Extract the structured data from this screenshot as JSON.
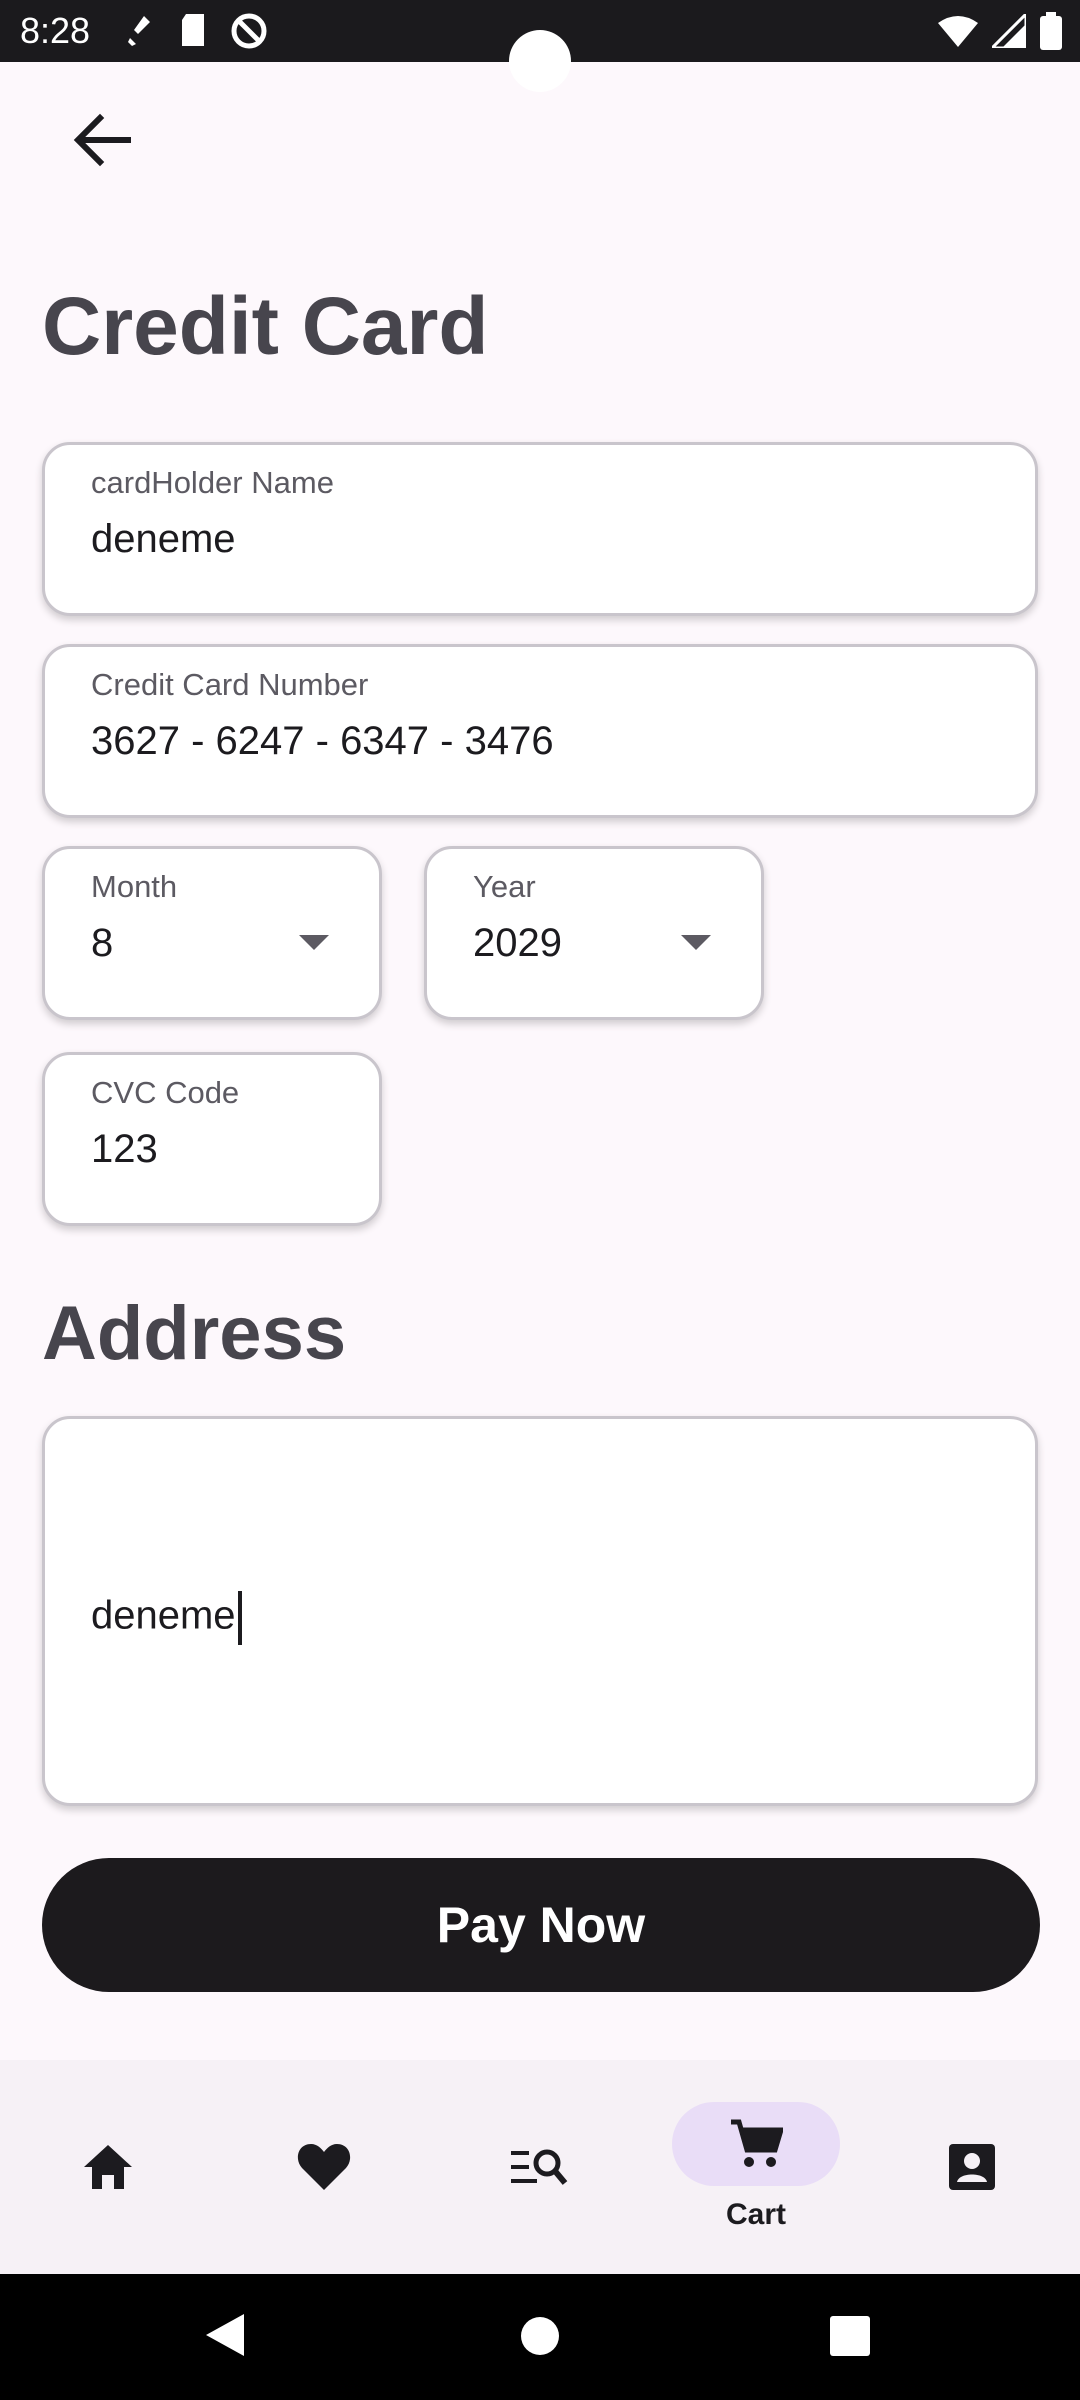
{
  "status_bar": {
    "time": "8:28"
  },
  "header": {
    "back_icon": "arrow-left-icon"
  },
  "credit_card": {
    "title": "Credit Card",
    "cardholder": {
      "label": "cardHolder Name",
      "value": "deneme"
    },
    "number": {
      "label": "Credit Card Number",
      "value": "3627 - 6247 - 6347 - 3476"
    },
    "month": {
      "label": "Month",
      "value": "8"
    },
    "year": {
      "label": "Year",
      "value": "2029"
    },
    "cvc": {
      "label": "CVC Code",
      "value": "123"
    }
  },
  "address": {
    "title": "Address",
    "value": "deneme"
  },
  "pay_button": {
    "label": "Pay Now"
  },
  "bottom_nav": {
    "items": [
      {
        "icon": "home-icon"
      },
      {
        "icon": "heart-icon"
      },
      {
        "icon": "search-list-icon"
      },
      {
        "icon": "cart-icon",
        "label": "Cart",
        "active": true
      },
      {
        "icon": "contact-icon"
      }
    ]
  },
  "colors": {
    "background": "#fdf8fc",
    "active_pill": "#e9ddf7",
    "button": "#1c1a1d",
    "title": "#47454d"
  }
}
